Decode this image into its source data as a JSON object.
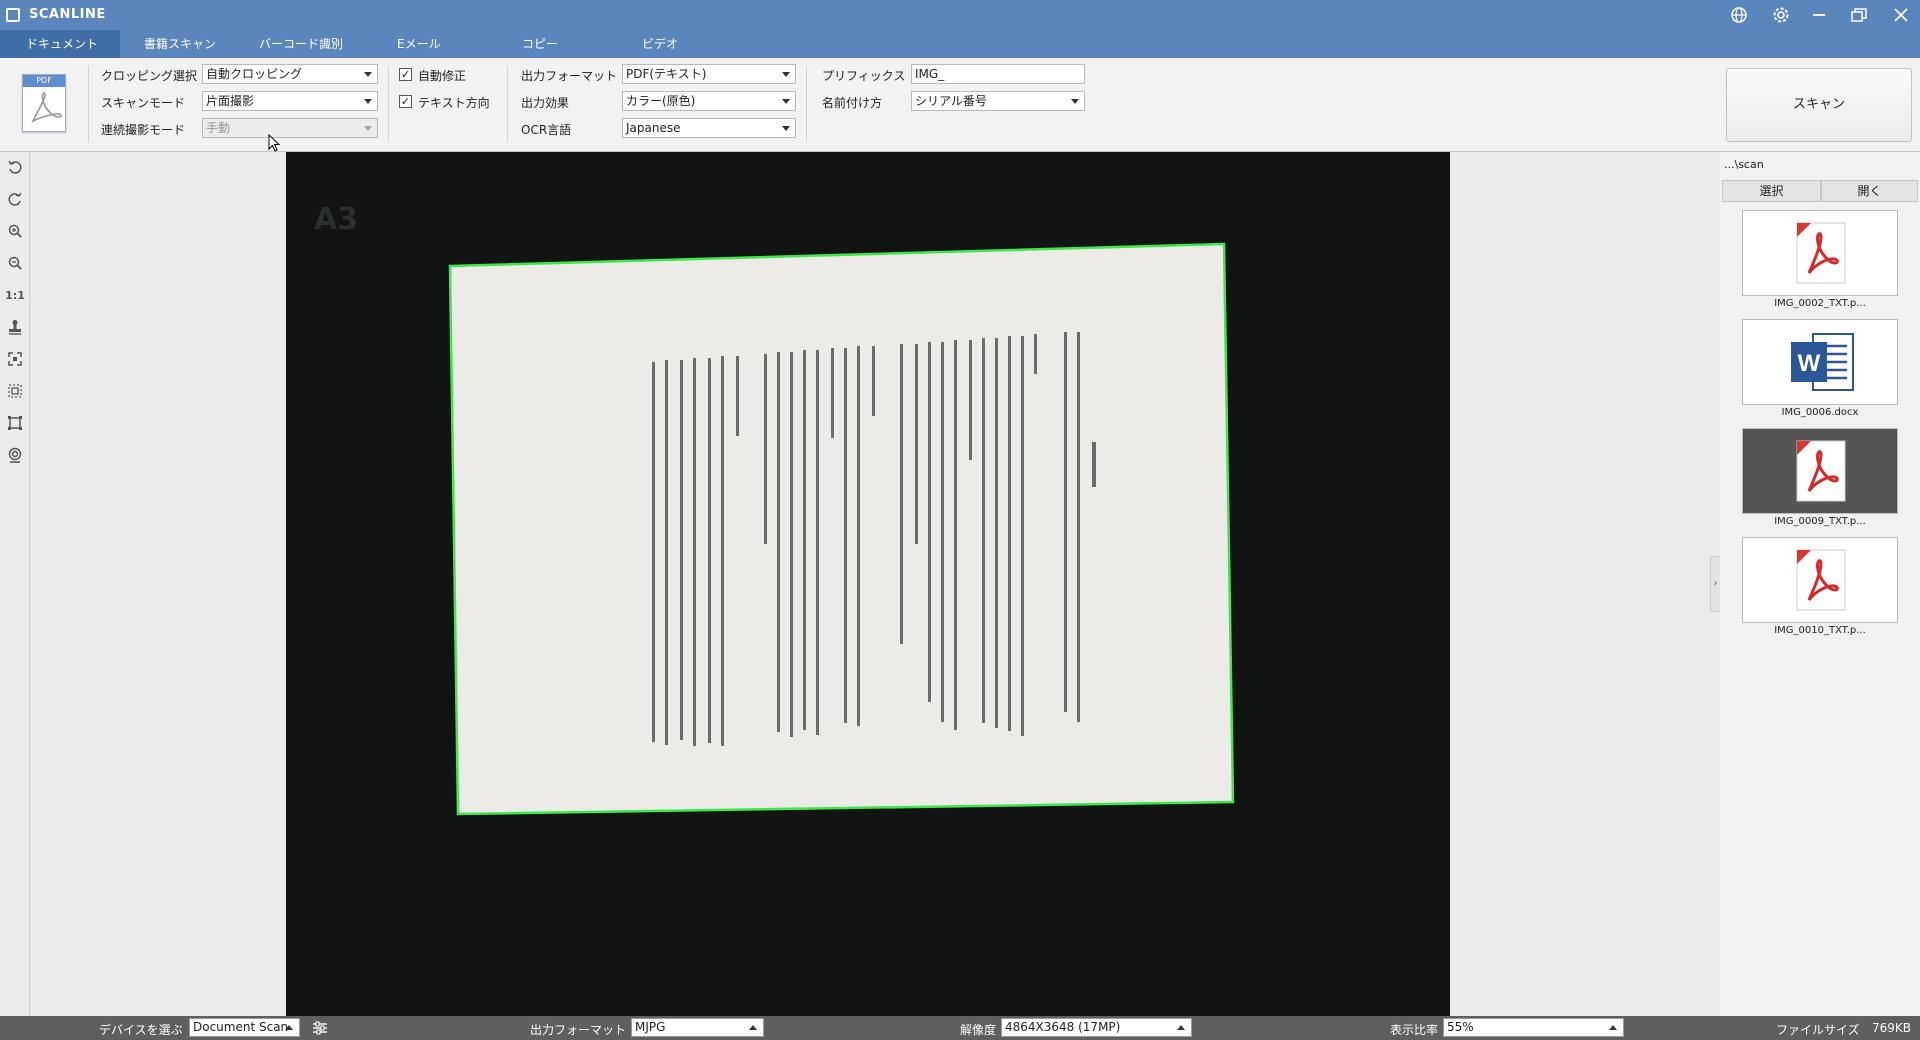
{
  "app": {
    "title": "SCANLINE"
  },
  "titlebar_icons": [
    "globe-icon",
    "gear-icon",
    "minimize-icon",
    "restore-icon",
    "close-icon"
  ],
  "tabs": [
    {
      "label": "ドキュメント",
      "active": true
    },
    {
      "label": "書籍スキャン",
      "active": false
    },
    {
      "label": "バーコード識別",
      "active": false
    },
    {
      "label": "Eメール",
      "active": false
    },
    {
      "label": "コピー",
      "active": false
    },
    {
      "label": "ビデオ",
      "active": false
    }
  ],
  "toolbar": {
    "doc_icon_label": "PDF",
    "crop_label": "クロッピング選択",
    "crop_value": "自動クロッピング",
    "scan_mode_label": "スキャンモード",
    "scan_mode_value": "片面撮影",
    "continuous_label": "連続撮影モード",
    "continuous_value": "手動",
    "auto_correct_label": "自動修正",
    "auto_correct_checked": "✓",
    "text_direction_label": "テキスト方向",
    "text_direction_checked": "✓",
    "output_format_label": "出力フォーマット",
    "output_format_value": "PDF(テキスト)",
    "output_effect_label": "出力効果",
    "output_effect_value": "カラー(原色)",
    "ocr_label": "OCR言語",
    "ocr_value": "Japanese",
    "prefix_label": "プリフィックス",
    "prefix_value": "IMG_",
    "naming_label": "名前付け方",
    "naming_value": "シリアル番号",
    "scan_button": "スキャン"
  },
  "left_tools": [
    "rotate-left-icon",
    "rotate-right-icon",
    "zoom-in-icon",
    "zoom-out-icon",
    "actual-size-icon",
    "stamp-icon",
    "fit-icon",
    "crop-select-icon",
    "crop-frame-icon",
    "camera-settings-icon"
  ],
  "left_tools_text": {
    "actual_size": "1:1"
  },
  "viewer": {
    "watermark": "A3"
  },
  "right_panel": {
    "path": "...\\scan",
    "select_button": "選択",
    "open_button": "開く",
    "files": [
      {
        "name": "IMG_0002_TXT.p...",
        "type": "pdf",
        "selected": false
      },
      {
        "name": "IMG_0006.docx",
        "type": "word",
        "selected": false
      },
      {
        "name": "IMG_0009_TXT.p...",
        "type": "pdf",
        "selected": true
      },
      {
        "name": "IMG_0010_TXT.p...",
        "type": "pdf",
        "selected": false
      }
    ]
  },
  "status": {
    "device_label": "デバイスを選ぶ",
    "device_value": "Document Scan",
    "output_format_label": "出力フォーマット",
    "output_format_value": "MJPG",
    "resolution_label": "解像度",
    "resolution_value": "4864X3648 (17MP)",
    "zoom_label": "表示比率",
    "zoom_value": "55%",
    "filesize_label": "ファイルサイズ",
    "filesize_value": "769KB"
  },
  "colors": {
    "titlebar": "#5a86bd",
    "active_tab": "#3f6ea8",
    "crop_border": "#3fe84a",
    "viewer_bg": "#111412",
    "statusbar": "#5f5f5f"
  }
}
